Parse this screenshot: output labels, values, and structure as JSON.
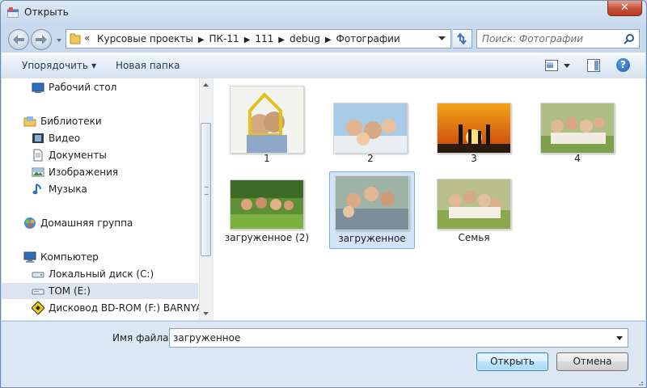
{
  "window": {
    "title": "Открыть"
  },
  "address": {
    "crumbs": [
      "Курсовые проекты",
      "ПК-11",
      "111",
      "debug",
      "Фотографии"
    ]
  },
  "search": {
    "placeholder": "Поиск: Фотографии"
  },
  "toolbar": {
    "organize": "Упорядочить",
    "new_folder": "Новая папка"
  },
  "navpane": {
    "items": [
      {
        "label": "Рабочий стол",
        "icon": "desktop-icon"
      },
      {
        "label": "Библиотеки",
        "icon": "libraries-icon"
      },
      {
        "label": "Видео",
        "icon": "video-icon"
      },
      {
        "label": "Документы",
        "icon": "documents-icon"
      },
      {
        "label": "Изображения",
        "icon": "pictures-icon"
      },
      {
        "label": "Музыка",
        "icon": "music-icon"
      },
      {
        "label": "Домашняя группа",
        "icon": "homegroup-icon"
      },
      {
        "label": "Компьютер",
        "icon": "computer-icon"
      },
      {
        "label": "Локальный диск (C:)",
        "icon": "local-disk-icon"
      },
      {
        "label": "ТОМ (E:)",
        "icon": "removable-drive-icon",
        "selected": true
      },
      {
        "label": "Дисковод BD-ROM (F:) BARNYARD",
        "icon": "bd-rom-icon"
      }
    ]
  },
  "files": [
    {
      "name": "1"
    },
    {
      "name": "2"
    },
    {
      "name": "3"
    },
    {
      "name": "4"
    },
    {
      "name": "загруженное (2)"
    },
    {
      "name": "загруженное",
      "selected": true
    },
    {
      "name": "Семья"
    }
  ],
  "bottom": {
    "filename_label": "Имя файла:",
    "filename_value": "загруженное",
    "open_button": "Открыть",
    "cancel_button": "Отмена"
  },
  "icons": {
    "close": "close-icon",
    "back": "back-arrow-icon",
    "forward": "forward-arrow-icon",
    "refresh": "refresh-icon",
    "search": "search-icon",
    "help": "help-icon"
  },
  "colors": {
    "selection": "#d1e4f9",
    "accent": "#3c7fb1",
    "close": "#c7553b"
  }
}
